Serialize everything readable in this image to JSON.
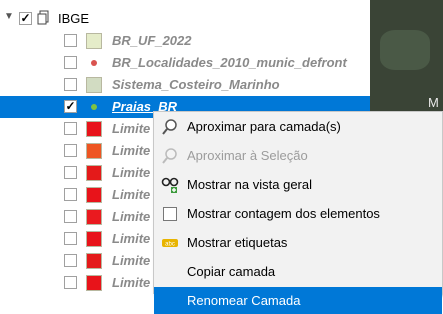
{
  "group": {
    "name": "IBGE",
    "checked": true,
    "expanded": true
  },
  "layers": [
    {
      "name": "BR_UF_2022",
      "checked": false,
      "symbol": "fill",
      "color": "#e5ecc9"
    },
    {
      "name": "BR_Localidades_2010_munic_defront",
      "checked": false,
      "symbol": "point",
      "color": "#d9534f"
    },
    {
      "name": "Sistema_Costeiro_Marinho",
      "checked": false,
      "symbol": "fill",
      "color": "#d2dcc2"
    },
    {
      "name": "Praias_BR",
      "checked": true,
      "symbol": "point",
      "color": "#7fc241",
      "selected": true
    },
    {
      "name": "Limite",
      "checked": false,
      "symbol": "fill",
      "color": "#e8131a"
    },
    {
      "name": "Limite",
      "checked": false,
      "symbol": "fill",
      "color": "#ee5522"
    },
    {
      "name": "Limite",
      "checked": false,
      "symbol": "fill",
      "color": "#e41a1a"
    },
    {
      "name": "Limite",
      "checked": false,
      "symbol": "fill",
      "color": "#e8131a"
    },
    {
      "name": "Limite",
      "checked": false,
      "symbol": "fill",
      "color": "#ea1a1f"
    },
    {
      "name": "Limite",
      "checked": false,
      "symbol": "fill",
      "color": "#e8131a"
    },
    {
      "name": "Limite",
      "checked": false,
      "symbol": "fill",
      "color": "#e41a1a"
    },
    {
      "name": "Limite",
      "checked": false,
      "symbol": "fill",
      "color": "#e8131a"
    }
  ],
  "map": {
    "label": "M"
  },
  "context_menu": {
    "items": [
      {
        "label": "Aproximar para camada(s)",
        "icon": "zoom-to-layer-icon",
        "enabled": true
      },
      {
        "label": "Aproximar à Seleção",
        "icon": "zoom-to-selection-icon",
        "enabled": false
      },
      {
        "label": "Mostrar na vista geral",
        "icon": "overview-icon",
        "enabled": true
      },
      {
        "label": "Mostrar contagem dos elementos",
        "icon": "checkbox-icon",
        "enabled": true
      },
      {
        "label": "Mostrar etiquetas",
        "icon": "labels-icon",
        "enabled": true
      },
      {
        "label": "Copiar camada",
        "icon": "",
        "enabled": true
      },
      {
        "label": "Renomear Camada",
        "icon": "",
        "enabled": true,
        "highlighted": true
      }
    ]
  },
  "colors": {
    "selection": "#0078d7",
    "menu_bg": "#f2f2f2"
  }
}
